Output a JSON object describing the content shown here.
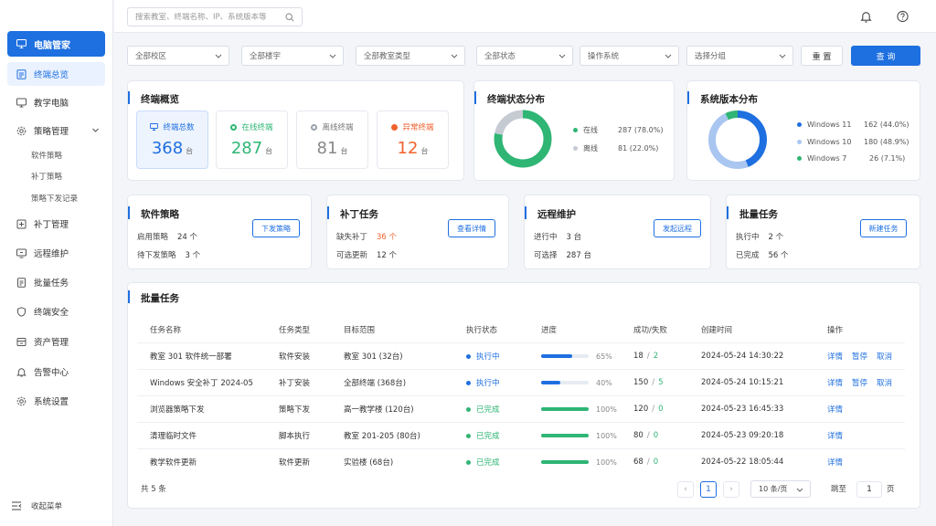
{
  "sidebar": {
    "brand": "电脑管家",
    "items": [
      {
        "label": "终端总览"
      },
      {
        "label": "教学电脑"
      },
      {
        "label": "策略管理"
      },
      {
        "label": "补丁管理"
      },
      {
        "label": "远程维护"
      },
      {
        "label": "批量任务"
      },
      {
        "label": "终端安全"
      },
      {
        "label": "资产管理"
      },
      {
        "label": "告警中心"
      },
      {
        "label": "系统设置"
      }
    ],
    "sub_items": [
      "软件策略",
      "补丁策略",
      "策略下发记录"
    ],
    "collapse": "收起菜单"
  },
  "topbar": {
    "search_placeholder": "搜索教室、终端名称、IP、系统版本等"
  },
  "filters": {
    "campus": "全部校区",
    "building": "全部楼宇",
    "room_type": "全部教室类型",
    "status": "全部状态",
    "os": "操作系统",
    "group": "选择分组",
    "reset": "重 置",
    "query": "查 询"
  },
  "overview": {
    "title": "终端概览",
    "stats": [
      {
        "label": "终端总数",
        "value": "368",
        "unit": "台"
      },
      {
        "label": "在线终端",
        "value": "287",
        "unit": "台"
      },
      {
        "label": "离线终端",
        "value": "81",
        "unit": "台"
      },
      {
        "label": "异常终端",
        "value": "12",
        "unit": "台"
      }
    ]
  },
  "status_dist": {
    "title": "终端状态分布",
    "items": [
      {
        "label": "在线",
        "value": "287 (78.0%)",
        "count": 287,
        "color": "#2fb574"
      },
      {
        "label": "离线",
        "value": "81 (22.0%)",
        "count": 81,
        "color": "#c5cad3"
      }
    ]
  },
  "os_dist": {
    "title": "系统版本分布",
    "items": [
      {
        "label": "Windows 11",
        "value": "162 (44.0%)",
        "count": 162,
        "color": "#1e6fe0"
      },
      {
        "label": "Windows 10",
        "value": "180 (48.9%)",
        "count": 180,
        "color": "#a9c6f1"
      },
      {
        "label": "Windows 7",
        "value": "26 (7.1%)",
        "count": 26,
        "color": "#2fb574"
      }
    ]
  },
  "mini_cards": [
    {
      "title": "软件策略",
      "l1": "启用策略",
      "v1": "24 个",
      "l2": "待下发策略",
      "v2": "3 个",
      "btn": "下发策略"
    },
    {
      "title": "补丁任务",
      "l1": "缺失补丁",
      "v1": "36 个",
      "l2": "可选更新",
      "v2": "12 个",
      "btn": "查看详情"
    },
    {
      "title": "远程维护",
      "l1": "进行中",
      "v1": "3 台",
      "l2": "可选择",
      "v2": "287 台",
      "btn": "发起远程"
    },
    {
      "title": "批量任务",
      "l1": "执行中",
      "v1": "2 个",
      "l2": "已完成",
      "v2": "56 个",
      "btn": "新建任务"
    }
  ],
  "tasks": {
    "title": "批量任务",
    "headers": [
      "任务名称",
      "任务类型",
      "目标范围",
      "执行状态",
      "进度",
      "成功/失败",
      "创建时间",
      "操作"
    ],
    "rows": [
      {
        "name": "教室 301 软件统一部署",
        "type": "软件安装",
        "scope": "教室 301 (32台)",
        "status": "执行中",
        "progress": 65,
        "pct": "65%",
        "success": "18",
        "fail": "2",
        "time": "2024-05-24 14:30:22",
        "ops": [
          "详情",
          "暂停",
          "取消"
        ]
      },
      {
        "name": "Windows 安全补丁 2024-05",
        "type": "补丁安装",
        "scope": "全部终端 (368台)",
        "status": "执行中",
        "progress": 40,
        "pct": "40%",
        "success": "150",
        "fail": "5",
        "time": "2024-05-24 10:15:21",
        "ops": [
          "详情",
          "暂停",
          "取消"
        ]
      },
      {
        "name": "浏览器策略下发",
        "type": "策略下发",
        "scope": "高一教学楼 (120台)",
        "status": "已完成",
        "progress": 100,
        "pct": "100%",
        "success": "120",
        "fail": "0",
        "time": "2024-05-23 16:45:33",
        "ops": [
          "详情"
        ]
      },
      {
        "name": "清理临时文件",
        "type": "脚本执行",
        "scope": "教室 201-205 (80台)",
        "status": "已完成",
        "progress": 100,
        "pct": "100%",
        "success": "80",
        "fail": "0",
        "time": "2024-05-23 09:20:18",
        "ops": [
          "详情"
        ]
      },
      {
        "name": "教学软件更新",
        "type": "软件更新",
        "scope": "实验楼 (68台)",
        "status": "已完成",
        "progress": 100,
        "pct": "100%",
        "success": "68",
        "fail": "0",
        "time": "2024-05-22 18:05:44",
        "ops": [
          "详情"
        ]
      }
    ],
    "total": "共 5 条",
    "page": "1",
    "page_size": "10 条/页",
    "goto_label": "跳至",
    "goto_value": "1",
    "page_suffix": "页"
  },
  "colors": {
    "primary": "#1e6fe0",
    "success": "#2fb574",
    "offline": "#9aa1ad",
    "danger": "#f0622d"
  }
}
